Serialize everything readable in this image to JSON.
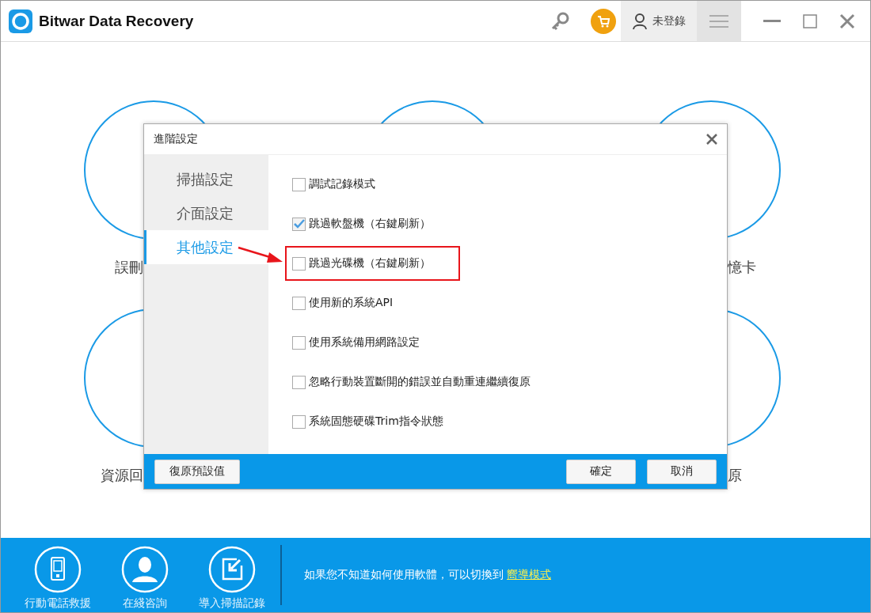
{
  "app": {
    "title": "Bitwar Data Recovery",
    "user": "未登錄"
  },
  "background_labels": [
    "誤刪",
    "憶卡",
    "資源回",
    "原"
  ],
  "dialog": {
    "title": "進階設定",
    "tabs": [
      {
        "label": "掃描設定",
        "selected": false
      },
      {
        "label": "介面設定",
        "selected": false
      },
      {
        "label": "其他設定",
        "selected": true
      }
    ],
    "options": [
      {
        "label": "調試記錄模式",
        "checked": false,
        "highlighted": false
      },
      {
        "label": "跳過軟盤機（右鍵刷新）",
        "checked": true,
        "highlighted": false
      },
      {
        "label": "跳過光碟機（右鍵刷新）",
        "checked": false,
        "highlighted": true
      },
      {
        "label": "使用新的系統API",
        "checked": false,
        "highlighted": false
      },
      {
        "label": "使用系統備用網路設定",
        "checked": false,
        "highlighted": false
      },
      {
        "label": "忽略行動裝置斷開的錯誤並自動重連繼續復原",
        "checked": false,
        "highlighted": false
      },
      {
        "label": "系統固態硬碟Trim指令狀態",
        "checked": false,
        "highlighted": false
      }
    ],
    "reset_button": "復原預設值",
    "ok_button": "確定",
    "cancel_button": "取消"
  },
  "bottom_tools": [
    {
      "label": "行動電話救援",
      "kind": "phone"
    },
    {
      "label": "在綫咨詢",
      "kind": "support"
    },
    {
      "label": "導入掃描記錄",
      "kind": "import"
    }
  ],
  "hint": {
    "text": "如果您不知道如何使用軟體，可以切換到",
    "link": "嚮導模式"
  }
}
